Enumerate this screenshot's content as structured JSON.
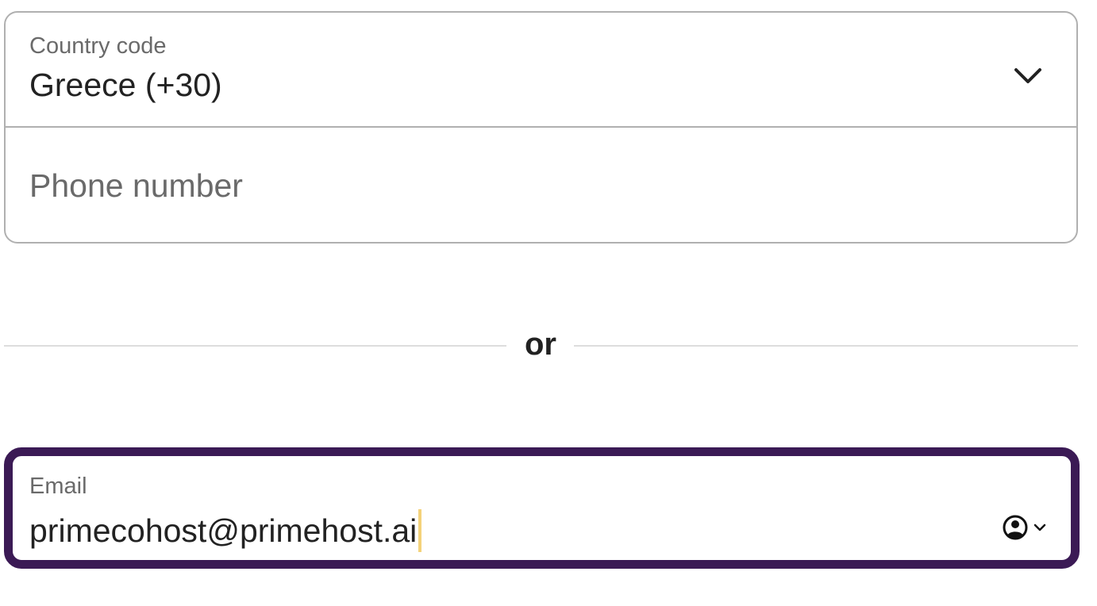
{
  "phone": {
    "country_label": "Country code",
    "country_value": "Greece (+30)",
    "phone_placeholder": "Phone number"
  },
  "divider": {
    "text": "or"
  },
  "email": {
    "label": "Email",
    "value": "primecohost@primehost.ai"
  },
  "icons": {
    "country_dropdown": "chevron-down-icon",
    "autofill": "contact-autofill-icon"
  },
  "colors": {
    "focus_border": "#3b1a55",
    "field_border": "#b0b0b0",
    "caret": "#f4d27a",
    "label": "#6a6a6a",
    "text": "#222222"
  }
}
